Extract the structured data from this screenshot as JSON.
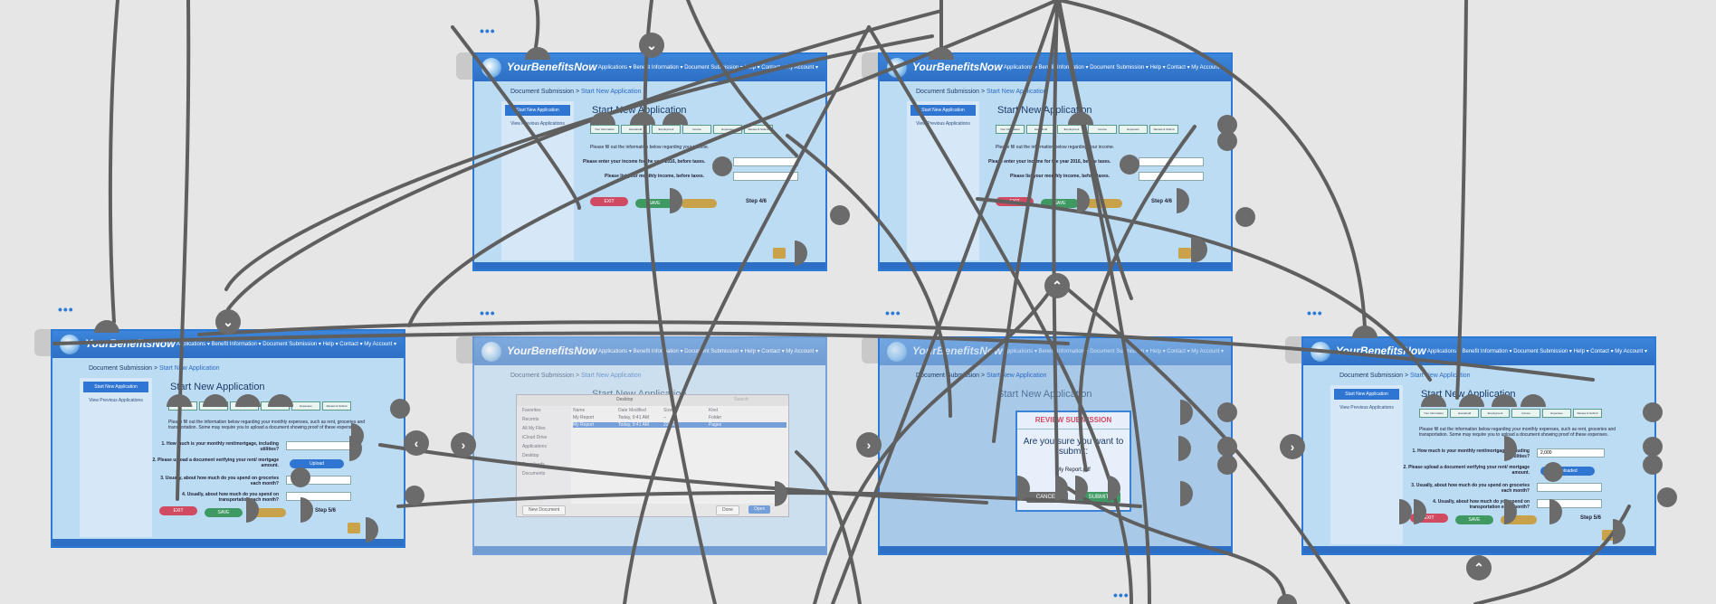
{
  "app": {
    "brand": "YourBenefitsNow",
    "nav": "Applications ▾   Benefit Information ▾   Document Submission ▾   Help ▾   Contact ▾   My Account ▾",
    "crumb_root": "Document Submission",
    "crumb_sep": ">",
    "crumb_current": "Start New Application",
    "side_active": "Start New Application",
    "side_other": "View Previous Applications",
    "page_title": "Start New Application",
    "steps": [
      "Your Information",
      "Household",
      "Employment",
      "Income",
      "Expenses",
      "Review & Submit"
    ],
    "exit_label": "EXIT",
    "save_label": "SAVE"
  },
  "screens": {
    "expenses": {
      "intro": "Please fill out the information below regarding your monthly expenses, such as rent, groceries and transportation. Some may require you to upload a document showing proof of these expenses.",
      "q1": "1. How much is your monthly rent/mortgage, including utilities?",
      "q2": "2. Please upload a document verifying your rent/ mortgage amount.",
      "q3": "3. Usually, about how much do you spend on groceries each month?",
      "q4": "4. Usually, about how much do you spend on transportation each month?",
      "upload": "Upload",
      "step": "Step 5/6"
    },
    "income": {
      "intro": "Please fill out the information below regarding your income.",
      "q1": "Please enter your income for the year 2016, before taxes.",
      "q2": "Please list your monthly income, before taxes.",
      "step": "Step 4/6"
    },
    "expenses_filled": {
      "amount": "2,000",
      "upload": "Uploaded"
    },
    "finder": {
      "location": "Desktop",
      "search": "Search",
      "sidebar": [
        "Favorites",
        "Recents",
        "All My Files",
        "iCloud Drive",
        "Applications",
        "Desktop",
        "Downloads",
        "Documents"
      ],
      "cols": [
        "Name",
        "Date Modified",
        "Size",
        "Kind"
      ],
      "rows": [
        [
          "My Report",
          "Today, 9:41 AM",
          "--",
          "Folder"
        ],
        [
          "My Report",
          "Today, 9:41 AM",
          "222 KB",
          "Pages"
        ]
      ],
      "new_doc": "New Document",
      "done": "Done",
      "open": "Open"
    },
    "review": {
      "title": "REVIEW SUBMISSION",
      "question": "Are you sure you want to submit:",
      "file": "My Report.pdf",
      "cancel": "CANCEL",
      "submit": "SUBMIT"
    }
  },
  "controls": {
    "more": "•••",
    "prev": "‹",
    "next": "›",
    "collapse": "⌄",
    "expand": "⌃"
  }
}
